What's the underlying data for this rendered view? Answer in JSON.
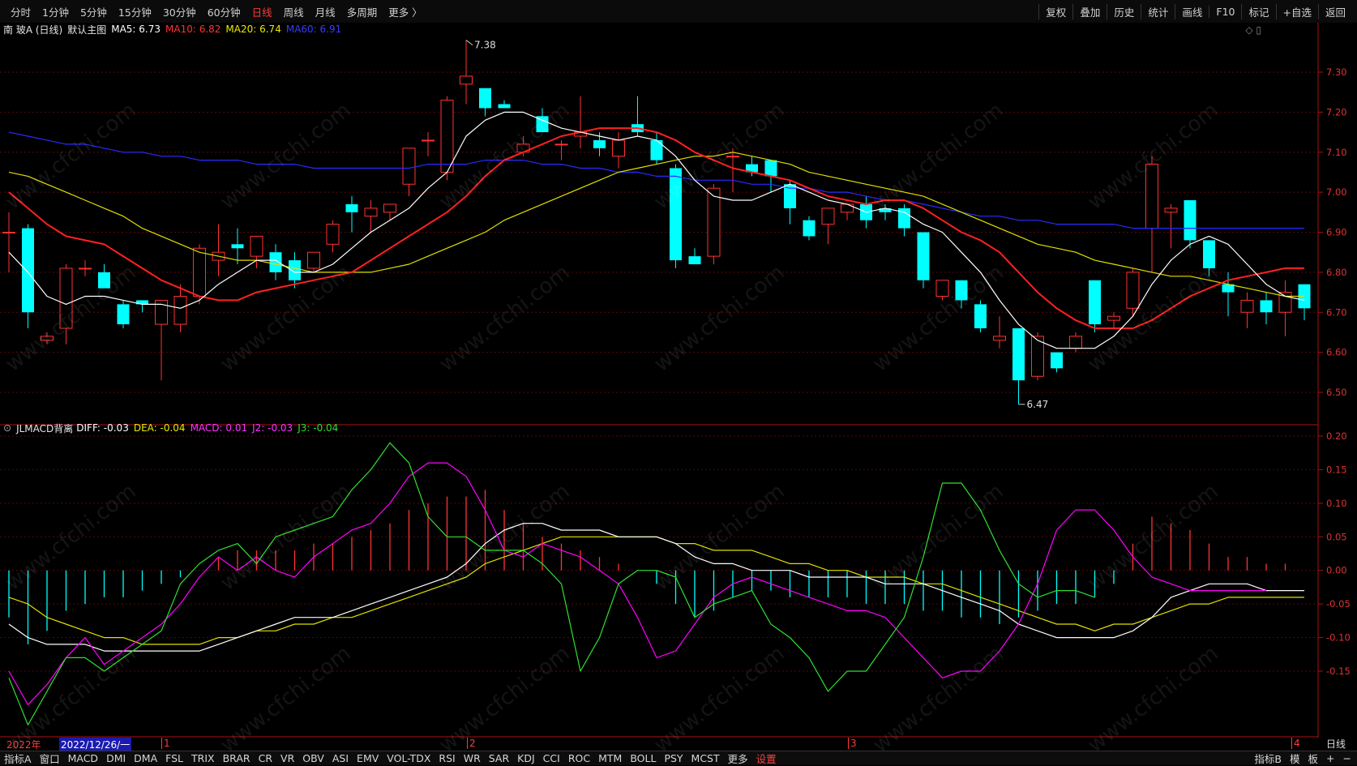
{
  "toolbar": {
    "periods": [
      "分时",
      "1分钟",
      "5分钟",
      "15分钟",
      "30分钟",
      "60分钟",
      "日线",
      "周线",
      "月线",
      "多周期",
      "更多 〉"
    ],
    "active_period": "日线",
    "tools": [
      "复权",
      "叠加",
      "历史",
      "统计",
      "画线",
      "F10",
      "标记",
      "+自选",
      "返回"
    ]
  },
  "main_info": {
    "stock": "南 玻A (日线)",
    "template": "默认主图",
    "ma5": "MA5: 6.73",
    "ma10": "MA10: 6.82",
    "ma20": "MA20: 6.74",
    "ma60": "MA60: 6.91"
  },
  "indicator_info": {
    "name": "JLMACD背离",
    "diff": "DIFF: -0.03",
    "dea": "DEA: -0.04",
    "macd": "MACD: 0.01",
    "j2": "J2: -0.03",
    "j3": "J3: -0.04"
  },
  "price_axis": [
    "7.30",
    "7.20",
    "7.10",
    "7.00",
    "6.90",
    "6.80",
    "6.70",
    "6.60",
    "6.50"
  ],
  "macd_axis": [
    "0.20",
    "0.15",
    "0.10",
    "0.05",
    "0.00",
    "-0.05",
    "-0.10",
    "-0.15"
  ],
  "annotations": {
    "high": "7.38",
    "low": "6.47"
  },
  "period_strip": {
    "year": "2022年",
    "date": "2022/12/26/一",
    "m1": "1",
    "m2": "2",
    "m3": "3",
    "m4": "4",
    "right": "日线"
  },
  "bottom_tabs": [
    "指标A",
    "窗口",
    "MACD",
    "DMI",
    "DMA",
    "FSL",
    "TRIX",
    "BRAR",
    "CR",
    "VR",
    "OBV",
    "ASI",
    "EMV",
    "VOL-TDX",
    "RSI",
    "WR",
    "SAR",
    "KDJ",
    "CCI",
    "ROC",
    "MTM",
    "BOLL",
    "PSY",
    "MCST",
    "更多",
    "设置"
  ],
  "bottom_right": [
    "指标B",
    "模",
    "板",
    "+",
    "−"
  ],
  "watermark": "www.cfchi.com",
  "colors": {
    "up": "#ff3232",
    "down": "#00ffff",
    "ma5": "#ffffff",
    "ma10": "#ff2020",
    "ma20": "#e0e000",
    "ma60": "#2a2aff",
    "j": "#ff00ff",
    "j3": "#30e030"
  },
  "chart_data": {
    "type": "candlestick",
    "ylim": [
      6.44,
      7.38
    ],
    "candles": [
      {
        "o": 6.9,
        "h": 6.95,
        "l": 6.8,
        "c": 6.9
      },
      {
        "o": 6.91,
        "h": 6.92,
        "l": 6.66,
        "c": 6.7
      },
      {
        "o": 6.63,
        "h": 6.65,
        "l": 6.62,
        "c": 6.64
      },
      {
        "o": 6.66,
        "h": 6.82,
        "l": 6.62,
        "c": 6.81
      },
      {
        "o": 6.81,
        "h": 6.83,
        "l": 6.79,
        "c": 6.81
      },
      {
        "o": 6.8,
        "h": 6.82,
        "l": 6.77,
        "c": 6.76
      },
      {
        "o": 6.72,
        "h": 6.73,
        "l": 6.66,
        "c": 6.67
      },
      {
        "o": 6.73,
        "h": 6.73,
        "l": 6.7,
        "c": 6.72
      },
      {
        "o": 6.67,
        "h": 6.73,
        "l": 6.53,
        "c": 6.73
      },
      {
        "o": 6.67,
        "h": 6.77,
        "l": 6.65,
        "c": 6.74
      },
      {
        "o": 6.74,
        "h": 6.87,
        "l": 6.72,
        "c": 6.86
      },
      {
        "o": 6.83,
        "h": 6.92,
        "l": 6.79,
        "c": 6.85
      },
      {
        "o": 6.87,
        "h": 6.91,
        "l": 6.82,
        "c": 6.86
      },
      {
        "o": 6.84,
        "h": 6.89,
        "l": 6.81,
        "c": 6.89
      },
      {
        "o": 6.85,
        "h": 6.87,
        "l": 6.78,
        "c": 6.8
      },
      {
        "o": 6.83,
        "h": 6.85,
        "l": 6.76,
        "c": 6.78
      },
      {
        "o": 6.81,
        "h": 6.85,
        "l": 6.8,
        "c": 6.85
      },
      {
        "o": 6.87,
        "h": 6.93,
        "l": 6.85,
        "c": 6.92
      },
      {
        "o": 6.97,
        "h": 6.99,
        "l": 6.9,
        "c": 6.95
      },
      {
        "o": 6.94,
        "h": 6.98,
        "l": 6.9,
        "c": 6.96
      },
      {
        "o": 6.95,
        "h": 6.97,
        "l": 6.93,
        "c": 6.97
      },
      {
        "o": 7.02,
        "h": 7.11,
        "l": 6.99,
        "c": 7.11
      },
      {
        "o": 7.13,
        "h": 7.15,
        "l": 7.09,
        "c": 7.13
      },
      {
        "o": 7.05,
        "h": 7.24,
        "l": 7.03,
        "c": 7.23
      },
      {
        "o": 7.27,
        "h": 7.38,
        "l": 7.22,
        "c": 7.29
      },
      {
        "o": 7.26,
        "h": 7.26,
        "l": 7.19,
        "c": 7.21
      },
      {
        "o": 7.22,
        "h": 7.23,
        "l": 7.21,
        "c": 7.21
      },
      {
        "o": 7.1,
        "h": 7.14,
        "l": 7.09,
        "c": 7.12
      },
      {
        "o": 7.19,
        "h": 7.21,
        "l": 7.15,
        "c": 7.15
      },
      {
        "o": 7.12,
        "h": 7.13,
        "l": 7.08,
        "c": 7.12
      },
      {
        "o": 7.14,
        "h": 7.24,
        "l": 7.11,
        "c": 7.15
      },
      {
        "o": 7.13,
        "h": 7.15,
        "l": 7.09,
        "c": 7.11
      },
      {
        "o": 7.09,
        "h": 7.15,
        "l": 7.06,
        "c": 7.13
      },
      {
        "o": 7.17,
        "h": 7.24,
        "l": 7.14,
        "c": 7.15
      },
      {
        "o": 7.13,
        "h": 7.15,
        "l": 7.07,
        "c": 7.08
      },
      {
        "o": 7.06,
        "h": 7.07,
        "l": 6.81,
        "c": 6.83
      },
      {
        "o": 6.84,
        "h": 6.86,
        "l": 6.82,
        "c": 6.82
      },
      {
        "o": 6.84,
        "h": 7.02,
        "l": 6.82,
        "c": 7.01
      },
      {
        "o": 7.09,
        "h": 7.11,
        "l": 7.0,
        "c": 7.09
      },
      {
        "o": 7.07,
        "h": 7.09,
        "l": 7.04,
        "c": 7.05
      },
      {
        "o": 7.08,
        "h": 7.08,
        "l": 7.0,
        "c": 7.04
      },
      {
        "o": 7.02,
        "h": 7.03,
        "l": 6.92,
        "c": 6.96
      },
      {
        "o": 6.93,
        "h": 6.94,
        "l": 6.88,
        "c": 6.89
      },
      {
        "o": 6.92,
        "h": 6.96,
        "l": 6.87,
        "c": 6.96
      },
      {
        "o": 6.95,
        "h": 6.97,
        "l": 6.93,
        "c": 6.97
      },
      {
        "o": 6.97,
        "h": 6.99,
        "l": 6.91,
        "c": 6.93
      },
      {
        "o": 6.96,
        "h": 6.97,
        "l": 6.93,
        "c": 6.95
      },
      {
        "o": 6.96,
        "h": 6.97,
        "l": 6.89,
        "c": 6.91
      },
      {
        "o": 6.9,
        "h": 6.9,
        "l": 6.76,
        "c": 6.78
      },
      {
        "o": 6.74,
        "h": 6.78,
        "l": 6.73,
        "c": 6.78
      },
      {
        "o": 6.78,
        "h": 6.78,
        "l": 6.71,
        "c": 6.73
      },
      {
        "o": 6.72,
        "h": 6.73,
        "l": 6.65,
        "c": 6.66
      },
      {
        "o": 6.63,
        "h": 6.69,
        "l": 6.61,
        "c": 6.64
      },
      {
        "o": 6.66,
        "h": 6.66,
        "l": 6.47,
        "c": 6.53
      },
      {
        "o": 6.54,
        "h": 6.65,
        "l": 6.53,
        "c": 6.64
      },
      {
        "o": 6.6,
        "h": 6.6,
        "l": 6.55,
        "c": 6.56
      },
      {
        "o": 6.61,
        "h": 6.65,
        "l": 6.6,
        "c": 6.64
      },
      {
        "o": 6.78,
        "h": 6.78,
        "l": 6.65,
        "c": 6.67
      },
      {
        "o": 6.68,
        "h": 6.7,
        "l": 6.66,
        "c": 6.69
      },
      {
        "o": 6.71,
        "h": 6.81,
        "l": 6.69,
        "c": 6.8
      },
      {
        "o": 6.91,
        "h": 7.09,
        "l": 6.8,
        "c": 7.07
      },
      {
        "o": 6.95,
        "h": 6.97,
        "l": 6.86,
        "c": 6.96
      },
      {
        "o": 6.98,
        "h": 6.98,
        "l": 6.86,
        "c": 6.88
      },
      {
        "o": 6.88,
        "h": 6.88,
        "l": 6.79,
        "c": 6.81
      },
      {
        "o": 6.77,
        "h": 6.8,
        "l": 6.69,
        "c": 6.75
      },
      {
        "o": 6.7,
        "h": 6.75,
        "l": 6.66,
        "c": 6.73
      },
      {
        "o": 6.73,
        "h": 6.75,
        "l": 6.67,
        "c": 6.7
      },
      {
        "o": 6.7,
        "h": 6.78,
        "l": 6.64,
        "c": 6.75
      },
      {
        "o": 6.77,
        "h": 6.77,
        "l": 6.68,
        "c": 6.71
      }
    ],
    "ma5": [
      6.85,
      6.8,
      6.74,
      6.72,
      6.74,
      6.74,
      6.73,
      6.72,
      6.72,
      6.71,
      6.73,
      6.77,
      6.8,
      6.83,
      6.83,
      6.8,
      6.8,
      6.82,
      6.86,
      6.9,
      6.93,
      6.96,
      7.01,
      7.05,
      7.14,
      7.18,
      7.2,
      7.2,
      7.18,
      7.16,
      7.15,
      7.14,
      7.13,
      7.14,
      7.13,
      7.09,
      7.03,
      6.99,
      6.98,
      6.98,
      7.0,
      7.02,
      7.0,
      6.98,
      6.97,
      6.95,
      6.96,
      6.95,
      6.92,
      6.9,
      6.85,
      6.8,
      6.73,
      6.67,
      6.63,
      6.61,
      6.61,
      6.61,
      6.64,
      6.69,
      6.77,
      6.83,
      6.87,
      6.89,
      6.87,
      6.82,
      6.77,
      6.74,
      6.73
    ],
    "ma10": [
      7.0,
      6.96,
      6.92,
      6.89,
      6.88,
      6.87,
      6.84,
      6.81,
      6.78,
      6.76,
      6.74,
      6.73,
      6.73,
      6.75,
      6.76,
      6.77,
      6.78,
      6.79,
      6.8,
      6.83,
      6.86,
      6.89,
      6.92,
      6.95,
      6.99,
      7.04,
      7.08,
      7.1,
      7.12,
      7.14,
      7.15,
      7.16,
      7.16,
      7.16,
      7.15,
      7.13,
      7.1,
      7.08,
      7.06,
      7.05,
      7.04,
      7.03,
      7.01,
      6.99,
      6.98,
      6.97,
      6.98,
      6.98,
      6.96,
      6.93,
      6.9,
      6.88,
      6.85,
      6.8,
      6.75,
      6.71,
      6.68,
      6.66,
      6.66,
      6.66,
      6.68,
      6.71,
      6.74,
      6.76,
      6.78,
      6.79,
      6.8,
      6.81,
      6.81
    ],
    "ma20": [
      7.05,
      7.04,
      7.02,
      7.0,
      6.98,
      6.96,
      6.94,
      6.91,
      6.89,
      6.87,
      6.85,
      6.84,
      6.83,
      6.83,
      6.82,
      6.81,
      6.8,
      6.8,
      6.8,
      6.8,
      6.81,
      6.82,
      6.84,
      6.86,
      6.88,
      6.9,
      6.93,
      6.95,
      6.97,
      6.99,
      7.01,
      7.03,
      7.05,
      7.06,
      7.07,
      7.08,
      7.09,
      7.09,
      7.1,
      7.09,
      7.08,
      7.07,
      7.05,
      7.04,
      7.03,
      7.02,
      7.01,
      7.0,
      6.99,
      6.97,
      6.95,
      6.93,
      6.91,
      6.89,
      6.87,
      6.86,
      6.85,
      6.83,
      6.82,
      6.81,
      6.8,
      6.79,
      6.79,
      6.78,
      6.77,
      6.76,
      6.75,
      6.74,
      6.74
    ],
    "ma60": [
      7.15,
      7.14,
      7.13,
      7.12,
      7.12,
      7.11,
      7.1,
      7.1,
      7.09,
      7.09,
      7.08,
      7.08,
      7.08,
      7.07,
      7.07,
      7.07,
      7.06,
      7.06,
      7.06,
      7.06,
      7.06,
      7.06,
      7.07,
      7.07,
      7.07,
      7.08,
      7.08,
      7.08,
      7.07,
      7.07,
      7.06,
      7.06,
      7.05,
      7.05,
      7.04,
      7.04,
      7.03,
      7.03,
      7.03,
      7.02,
      7.02,
      7.01,
      7.01,
      7.0,
      7.0,
      6.99,
      6.98,
      6.98,
      6.97,
      6.96,
      6.95,
      6.94,
      6.94,
      6.93,
      6.93,
      6.92,
      6.92,
      6.92,
      6.92,
      6.91,
      6.91,
      6.91,
      6.91,
      6.91,
      6.91,
      6.91,
      6.91,
      6.91,
      6.91
    ],
    "macd_ylim": [
      -0.245,
      0.22
    ],
    "diff": [
      -0.08,
      -0.1,
      -0.11,
      -0.11,
      -0.11,
      -0.12,
      -0.12,
      -0.12,
      -0.12,
      -0.12,
      -0.12,
      -0.11,
      -0.1,
      -0.09,
      -0.08,
      -0.07,
      -0.07,
      -0.07,
      -0.06,
      -0.05,
      -0.04,
      -0.03,
      -0.02,
      -0.01,
      0.01,
      0.04,
      0.06,
      0.07,
      0.07,
      0.06,
      0.06,
      0.06,
      0.05,
      0.05,
      0.05,
      0.04,
      0.02,
      0.01,
      0.01,
      0.0,
      0.0,
      0.0,
      -0.01,
      -0.01,
      -0.01,
      -0.01,
      -0.02,
      -0.02,
      -0.02,
      -0.03,
      -0.04,
      -0.05,
      -0.06,
      -0.08,
      -0.09,
      -0.1,
      -0.1,
      -0.1,
      -0.1,
      -0.09,
      -0.07,
      -0.04,
      -0.03,
      -0.02,
      -0.02,
      -0.02,
      -0.03,
      -0.03,
      -0.03
    ],
    "dea": [
      -0.04,
      -0.05,
      -0.07,
      -0.08,
      -0.09,
      -0.1,
      -0.1,
      -0.11,
      -0.11,
      -0.11,
      -0.11,
      -0.1,
      -0.1,
      -0.09,
      -0.09,
      -0.08,
      -0.08,
      -0.07,
      -0.07,
      -0.06,
      -0.05,
      -0.04,
      -0.03,
      -0.02,
      -0.01,
      0.01,
      0.02,
      0.03,
      0.04,
      0.05,
      0.05,
      0.05,
      0.05,
      0.05,
      0.05,
      0.04,
      0.04,
      0.03,
      0.03,
      0.03,
      0.02,
      0.01,
      0.01,
      0.0,
      0.0,
      -0.01,
      -0.01,
      -0.01,
      -0.02,
      -0.02,
      -0.03,
      -0.04,
      -0.05,
      -0.06,
      -0.07,
      -0.08,
      -0.08,
      -0.09,
      -0.08,
      -0.08,
      -0.07,
      -0.06,
      -0.05,
      -0.05,
      -0.04,
      -0.04,
      -0.04,
      -0.04,
      -0.04
    ],
    "macd_bar": [
      -0.07,
      -0.11,
      -0.09,
      -0.06,
      -0.05,
      -0.04,
      -0.04,
      -0.03,
      -0.02,
      -0.01,
      0.0,
      0.02,
      0.03,
      0.03,
      0.03,
      0.03,
      0.04,
      0.04,
      0.05,
      0.06,
      0.07,
      0.09,
      0.1,
      0.11,
      0.11,
      0.12,
      0.09,
      0.07,
      0.05,
      0.04,
      0.03,
      0.02,
      0.01,
      0.0,
      -0.02,
      -0.05,
      -0.07,
      -0.06,
      -0.04,
      -0.03,
      -0.03,
      -0.04,
      -0.04,
      -0.04,
      -0.04,
      -0.05,
      -0.05,
      -0.05,
      -0.06,
      -0.06,
      -0.07,
      -0.07,
      -0.08,
      -0.07,
      -0.06,
      -0.05,
      -0.05,
      -0.04,
      -0.02,
      0.04,
      0.08,
      0.07,
      0.06,
      0.04,
      0.02,
      0.02,
      0.01,
      0.01
    ],
    "j2": [
      -0.15,
      -0.2,
      -0.17,
      -0.13,
      -0.1,
      -0.14,
      -0.12,
      -0.1,
      -0.08,
      -0.05,
      -0.01,
      0.02,
      0.0,
      0.02,
      0.0,
      -0.01,
      0.02,
      0.04,
      0.06,
      0.07,
      0.1,
      0.14,
      0.16,
      0.16,
      0.14,
      0.09,
      0.03,
      0.02,
      0.04,
      0.03,
      0.02,
      0.0,
      -0.02,
      -0.07,
      -0.13,
      -0.12,
      -0.08,
      -0.04,
      -0.02,
      -0.01,
      -0.02,
      -0.03,
      -0.04,
      -0.05,
      -0.06,
      -0.06,
      -0.07,
      -0.1,
      -0.13,
      -0.16,
      -0.15,
      -0.15,
      -0.12,
      -0.08,
      -0.02,
      0.06,
      0.09,
      0.09,
      0.06,
      0.02,
      -0.01,
      -0.02,
      -0.03,
      -0.03,
      -0.03,
      -0.03,
      -0.03
    ],
    "j3": [
      -0.16,
      -0.23,
      -0.18,
      -0.13,
      -0.13,
      -0.15,
      -0.13,
      -0.11,
      -0.09,
      -0.02,
      0.01,
      0.03,
      0.04,
      0.01,
      0.05,
      0.06,
      0.07,
      0.08,
      0.12,
      0.15,
      0.19,
      0.16,
      0.08,
      0.05,
      0.05,
      0.03,
      0.03,
      0.03,
      0.01,
      -0.02,
      -0.15,
      -0.1,
      -0.02,
      0.0,
      0.0,
      -0.01,
      -0.07,
      -0.05,
      -0.04,
      -0.03,
      -0.08,
      -0.1,
      -0.13,
      -0.18,
      -0.15,
      -0.15,
      -0.11,
      -0.07,
      0.02,
      0.13,
      0.13,
      0.09,
      0.03,
      -0.02,
      -0.04,
      -0.03,
      -0.03,
      -0.04
    ]
  }
}
